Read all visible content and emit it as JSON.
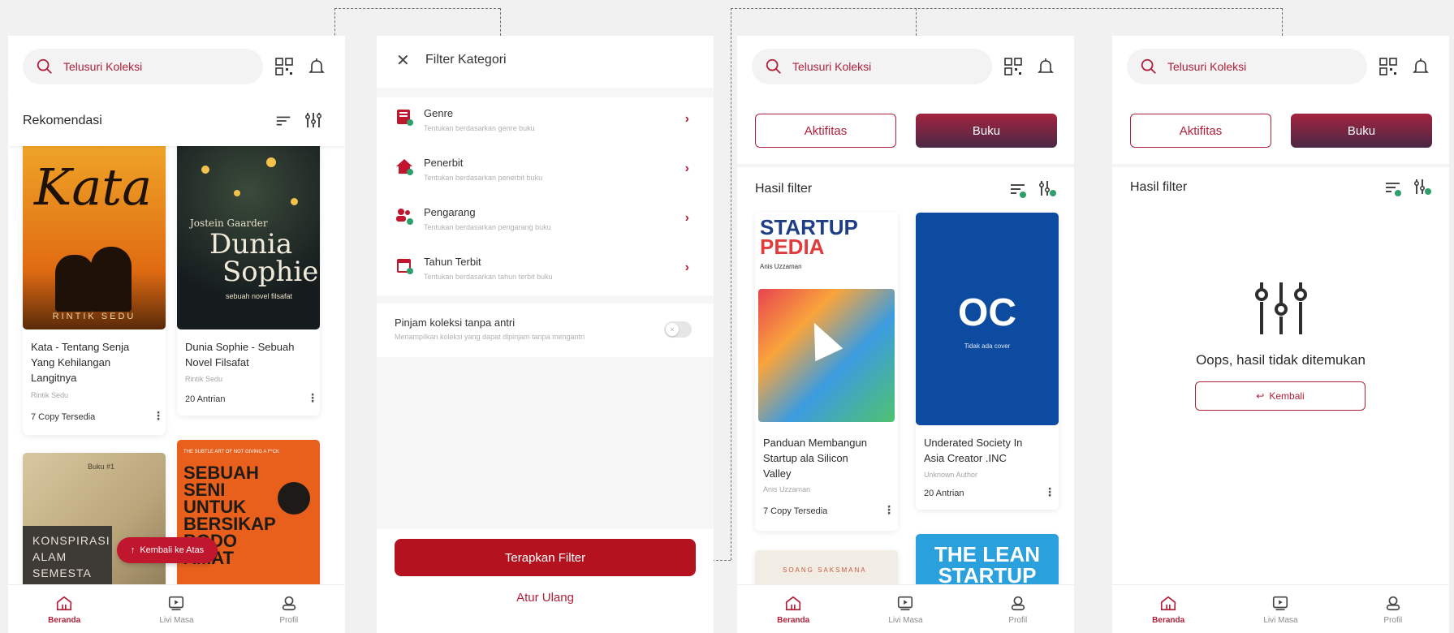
{
  "search": {
    "placeholder": "Telusuri Koleksi"
  },
  "nav": [
    {
      "label": "Beranda",
      "icon": "home-icon"
    },
    {
      "label": "Livi Masa",
      "icon": "media-icon"
    },
    {
      "label": "Profil",
      "icon": "profile-icon"
    }
  ],
  "screen1": {
    "section_title": "Rekomendasi",
    "books": [
      {
        "title_lines": [
          "Kata - Tentang Senja",
          "Yang Kehilangan",
          "Langitnya"
        ],
        "author": "Rintik Sedu",
        "stat": "7 Copy Tersedia",
        "cover_title": "Kata",
        "cover_author": "RINTIK SEDU"
      },
      {
        "title_lines": [
          "Dunia Sophie - Sebuah",
          "Novel Filsafat"
        ],
        "author": "Rintik Sedu",
        "stat": "20 Antrian",
        "cover_author": "Jostein Gaarder",
        "cover_title_1": "Dunia",
        "cover_title_2": "Sophie",
        "cover_sub": "sebuah novel filsafat"
      },
      {
        "cover_small": "Buku #1",
        "cover_lines": [
          "KONSPIRASI",
          "ALAM",
          "SEMESTA"
        ]
      },
      {
        "cover_top": "THE SUBTLE ART OF NOT GIVING A F*CK",
        "cover_lines": [
          "SEBUAH",
          "SENI",
          "UNTUK",
          "BERSIKAP",
          "BODO",
          "AMAT"
        ]
      }
    ],
    "back_to_top": "Kembali ke Atas"
  },
  "screen2": {
    "title": "Filter Kategori",
    "categories": [
      {
        "title": "Genre",
        "sub": "Tentukan berdasarkan genre buku",
        "icon": "genre-icon"
      },
      {
        "title": "Penerbit",
        "sub": "Tentukan berdasarkan penerbit buku",
        "icon": "publisher-icon"
      },
      {
        "title": "Pengarang",
        "sub": "Tentukan berdasarkan pengarang buku",
        "icon": "author-icon"
      },
      {
        "title": "Tahun Terbit",
        "sub": "Tentukan berdasarkan tahun terbit buku",
        "icon": "calendar-icon"
      }
    ],
    "toggle_title": "Pinjam koleksi tanpa antri",
    "toggle_sub": "Menampilkan koleksi yang dapat dipinjam tanpa mengantri",
    "apply": "Terapkan Filter",
    "reset": "Atur Ulang"
  },
  "tabs": {
    "activity": "Aktifitas",
    "book": "Buku"
  },
  "screen3": {
    "section_title": "Hasil filter",
    "books": [
      {
        "title_lines": [
          "Panduan Membangun",
          "Startup ala Silicon",
          "Valley"
        ],
        "author": "Anis Uzzaman",
        "stat": "7 Copy Tersedia",
        "cover_line1": "STARTUP",
        "cover_line2": "PEDIA",
        "cover_author": "Anis Uzzaman"
      },
      {
        "title_lines": [
          "Underated Society In",
          "Asia Creator .INC"
        ],
        "author": "Unknown Author",
        "stat": "20 Antrian",
        "cover_logo": "OC",
        "cover_note": "Tidak ada cover"
      },
      {
        "cover_text": "SOANG SAKSMANA"
      },
      {
        "cover_lines": [
          "THE LEAN",
          "STARTUP"
        ]
      }
    ]
  },
  "screen4": {
    "section_title": "Hasil filter",
    "empty_text": "Oops, hasil tidak ditemukan",
    "back": "Kembali"
  },
  "colors": {
    "primary": "#b0203a",
    "dark": "#4a2845"
  }
}
